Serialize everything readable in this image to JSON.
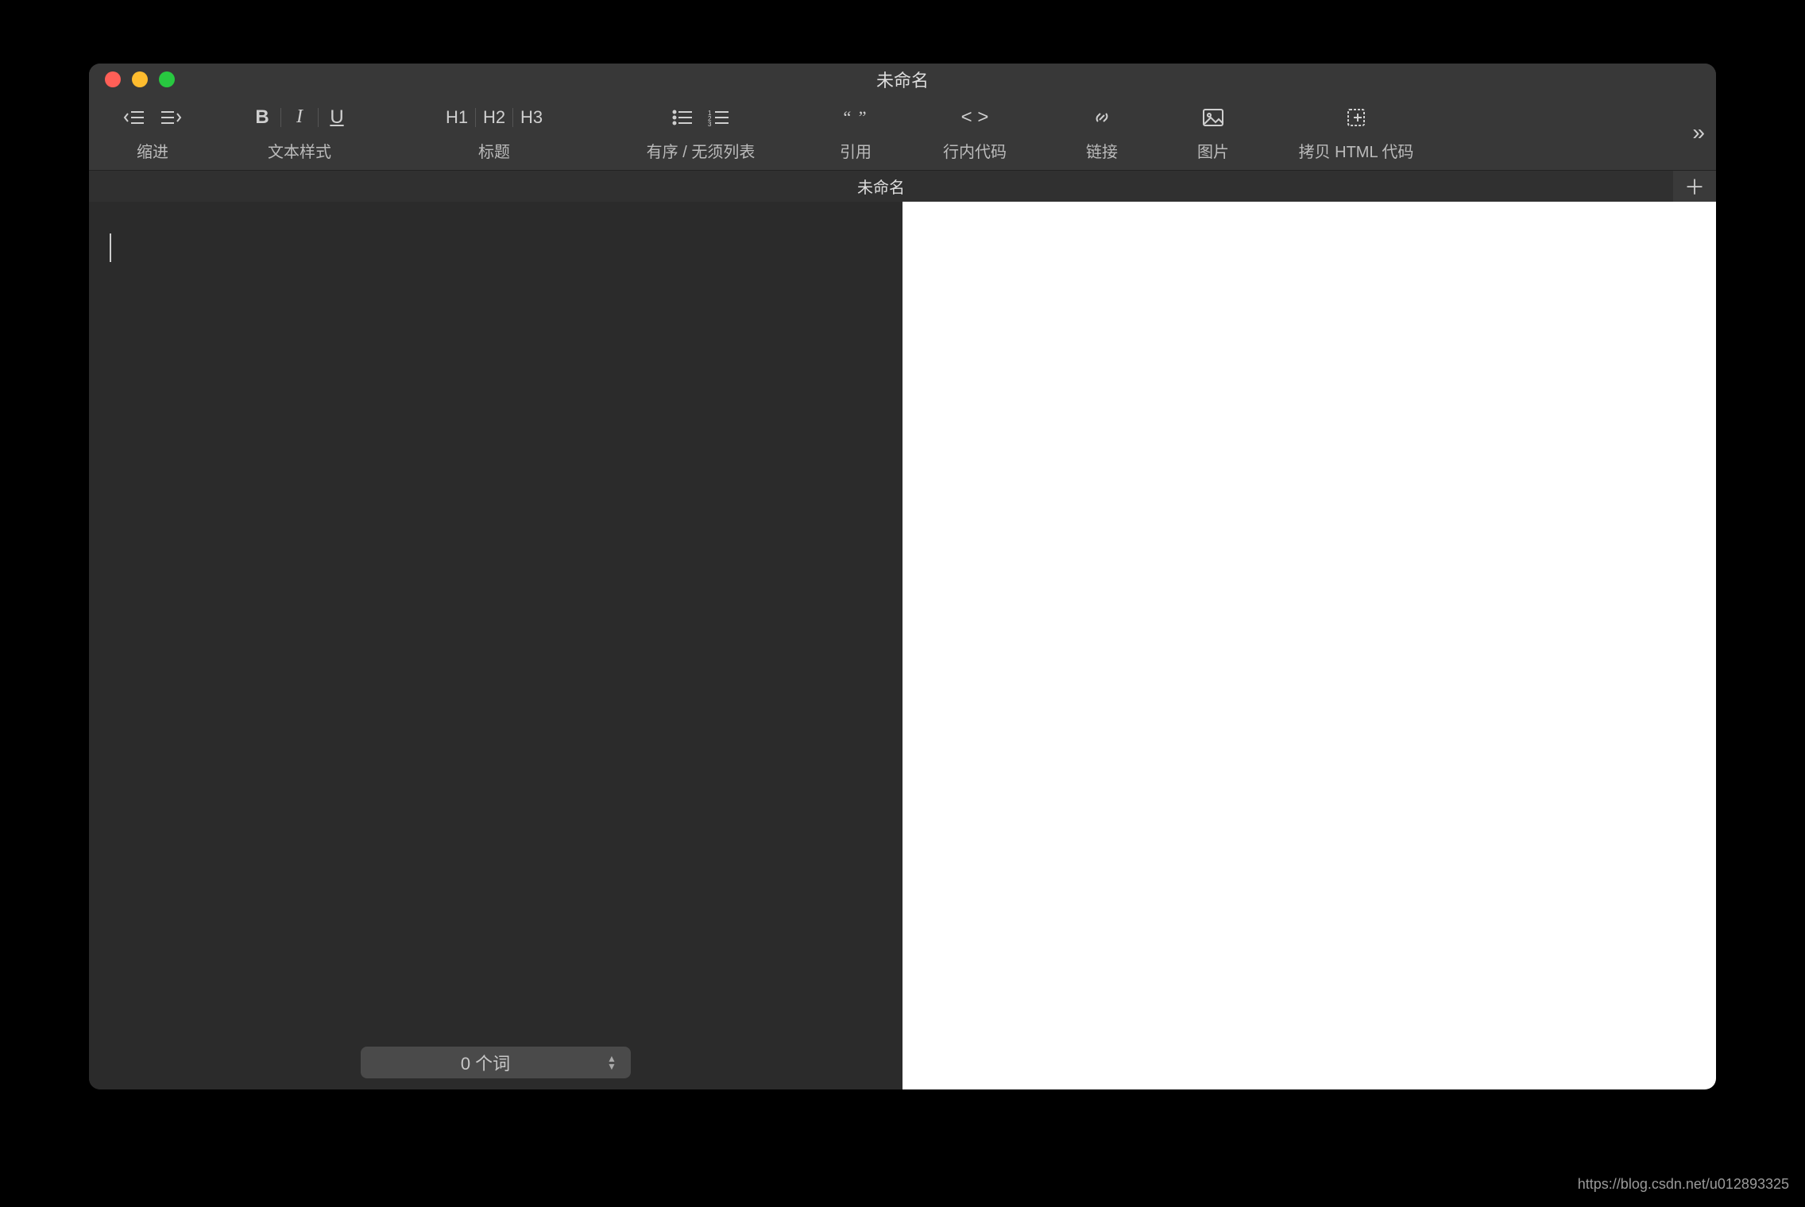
{
  "window": {
    "title": "未命名"
  },
  "toolbar": {
    "groups": {
      "indent": {
        "label": "缩进"
      },
      "style": {
        "label": "文本样式",
        "b": "B",
        "i": "I",
        "u": "U"
      },
      "heading": {
        "label": "标题",
        "h1": "H1",
        "h2": "H2",
        "h3": "H3"
      },
      "list": {
        "label": "有序 / 无须列表"
      },
      "quote": {
        "label": "引用"
      },
      "code": {
        "label": "行内代码"
      },
      "link": {
        "label": "链接"
      },
      "image": {
        "label": "图片"
      },
      "copyhtml": {
        "label": "拷贝 HTML 代码"
      }
    }
  },
  "tabs": {
    "active": "未命名"
  },
  "status": {
    "wordcount": "0 个词"
  },
  "watermark": "https://blog.csdn.net/u012893325"
}
